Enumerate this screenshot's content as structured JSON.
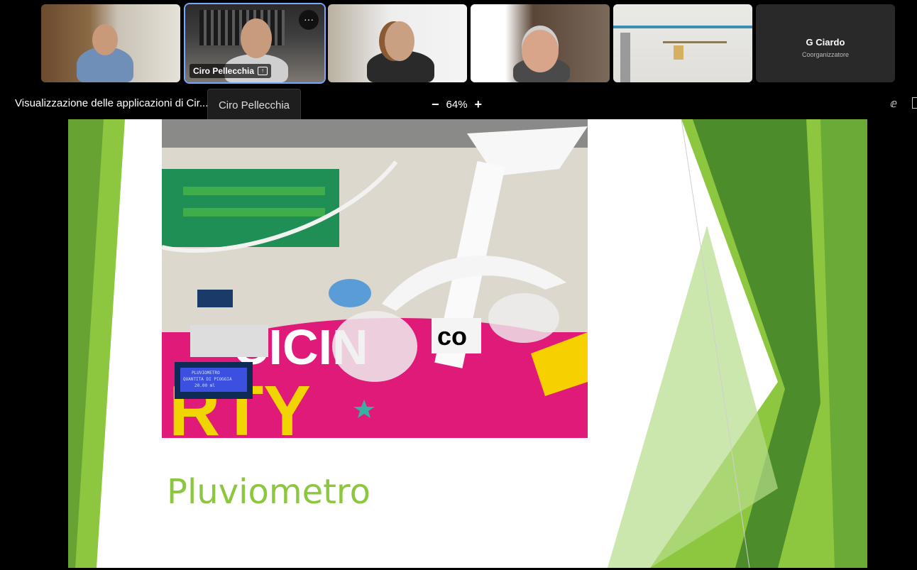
{
  "participants": [
    {
      "name": "",
      "role": ""
    },
    {
      "name": "Ciro Pellecchia",
      "role": ""
    },
    {
      "name": "",
      "role": ""
    },
    {
      "name": "",
      "role": ""
    },
    {
      "name": "",
      "role": ""
    },
    {
      "name": "G Ciardo",
      "role": "Coorganizzatore"
    }
  ],
  "more_options_label": "···",
  "toolbar": {
    "title": "Visualizzazione delle applicazioni di Cir...",
    "tooltip": "Ciro Pellecchia",
    "zoom_out": "−",
    "zoom_level": "64%",
    "zoom_in": "+"
  },
  "slide": {
    "title": "Pluviometro",
    "lcd_text_line1": "PLUVIOMETRO",
    "lcd_text_line2": "QUANTITA DI PIOGGIA",
    "lcd_text_line3": "20.00  ml",
    "letters_co": "co",
    "letters_cin": "CICIN",
    "letters_rty": "RTY"
  },
  "colors": {
    "accent_green": "#8dc63f",
    "dark_green": "#4c8c2b",
    "magenta": "#e01a78"
  }
}
